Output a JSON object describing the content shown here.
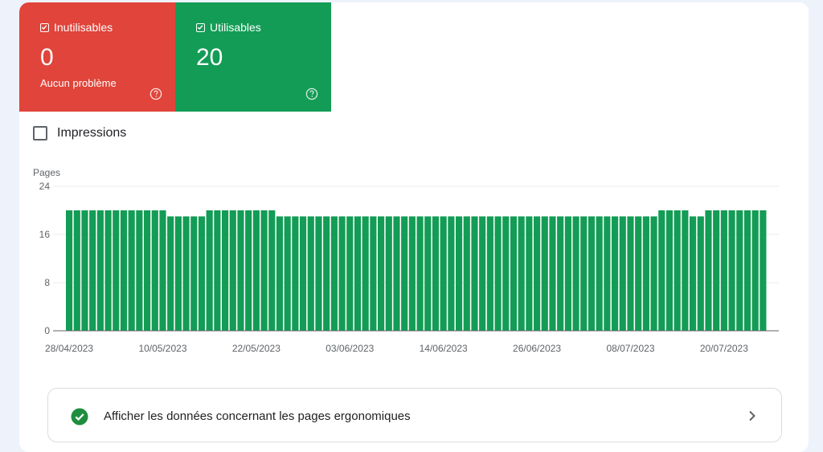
{
  "tiles": {
    "unusable": {
      "label": "Inutilisables",
      "value": "0",
      "subtext": "Aucun problème",
      "color": "#e0443a",
      "icon": "checkbox-checked-icon",
      "help_icon": "help-circle-icon"
    },
    "usable": {
      "label": "Utilisables",
      "value": "20",
      "color": "#139c55",
      "icon": "checkbox-checked-icon",
      "help_icon": "help-circle-icon"
    }
  },
  "impressions": {
    "label": "Impressions",
    "checked": false
  },
  "chart_data": {
    "type": "bar",
    "ylabel": "Pages",
    "xlabel": "",
    "title": "",
    "ylim": [
      0,
      24
    ],
    "yticks": [
      0,
      8,
      16,
      24
    ],
    "grid": true,
    "color": "#139c55",
    "start_date": "28/04/2023",
    "xtick_labels": [
      "28/04/2023",
      "10/05/2023",
      "22/05/2023",
      "03/06/2023",
      "14/06/2023",
      "26/06/2023",
      "08/07/2023",
      "20/07/2023"
    ],
    "values": [
      20,
      20,
      20,
      20,
      20,
      20,
      20,
      20,
      20,
      20,
      20,
      20,
      20,
      19,
      19,
      19,
      19,
      19,
      20,
      20,
      20,
      20,
      20,
      20,
      20,
      20,
      20,
      19,
      19,
      19,
      19,
      19,
      19,
      19,
      19,
      19,
      19,
      19,
      19,
      19,
      19,
      19,
      19,
      19,
      19,
      19,
      19,
      19,
      19,
      19,
      19,
      19,
      19,
      19,
      19,
      19,
      19,
      19,
      19,
      19,
      19,
      19,
      19,
      19,
      19,
      19,
      19,
      19,
      19,
      19,
      19,
      19,
      19,
      19,
      19,
      19,
      20,
      20,
      20,
      20,
      19,
      19,
      20,
      20,
      20,
      20,
      20,
      20,
      20,
      20
    ]
  },
  "details_link": {
    "label": "Afficher les données concernant les pages ergonomiques",
    "status_icon": "check-circle-icon",
    "chevron_icon": "chevron-right-icon",
    "status_color": "#1e8e3e"
  }
}
